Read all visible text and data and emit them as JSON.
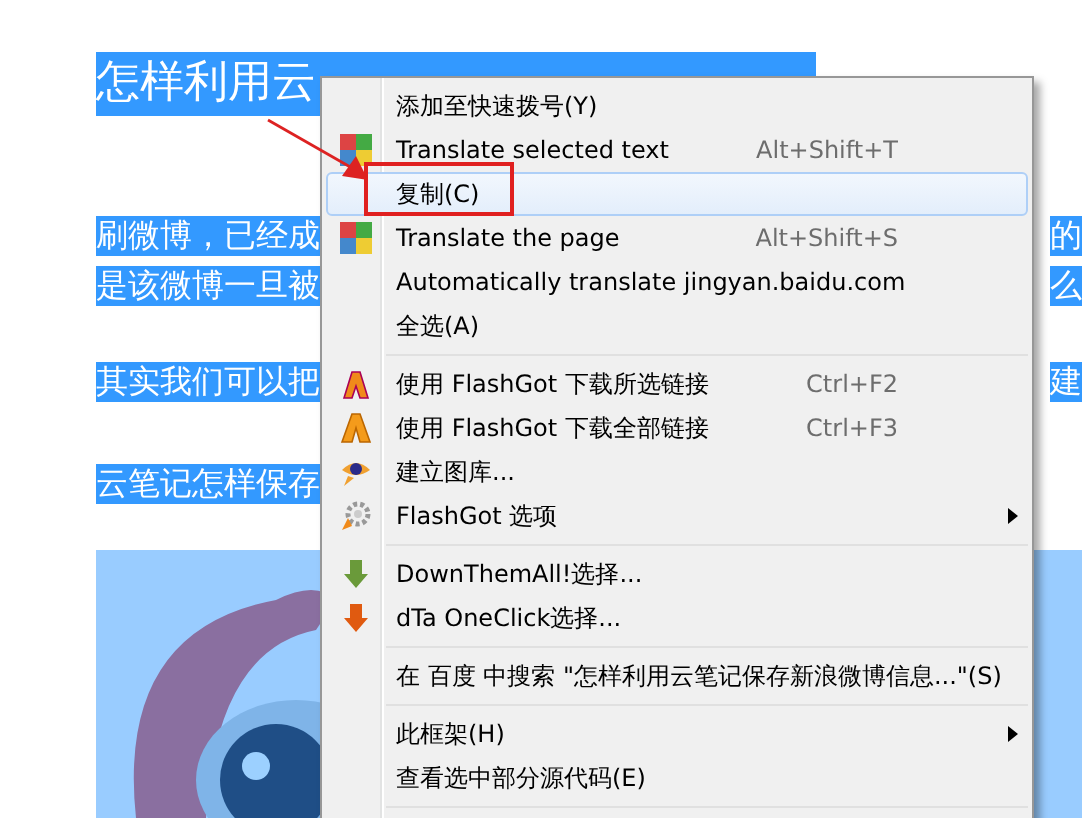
{
  "article": {
    "title": "怎样利用云",
    "lines": [
      {
        "left": "刷微博，已经成",
        "right": "的"
      },
      {
        "left": "是该微博一旦被",
        "right": "么"
      },
      {
        "left": "其实我们可以把",
        "right": "建"
      },
      {
        "left": "云笔记怎样保存"
      }
    ]
  },
  "context_menu": {
    "items": [
      {
        "kind": "plain",
        "label": "添加至快速拨号(Y)",
        "submenu": false,
        "selected": false
      },
      {
        "kind": "translate",
        "label": "Translate selected text",
        "shortcut": "Alt+Shift+T",
        "submenu": false,
        "selected": false
      },
      {
        "kind": "plain",
        "label": "复制(C)",
        "submenu": false,
        "selected": true
      },
      {
        "kind": "translate",
        "label": "Translate the page",
        "shortcut": "Alt+Shift+S",
        "submenu": false,
        "selected": false
      },
      {
        "kind": "plain",
        "label": "Automatically translate jingyan.baidu.com",
        "submenu": false,
        "selected": false
      },
      {
        "kind": "plain",
        "label": "全选(A)",
        "submenu": false,
        "selected": false
      },
      {
        "kind": "separator"
      },
      {
        "kind": "flashgot",
        "label": "使用 FlashGot 下载所选链接",
        "shortcut": "Ctrl+F2",
        "submenu": false,
        "selected": false
      },
      {
        "kind": "flashgot",
        "label": "使用 FlashGot 下载全部链接",
        "shortcut": "Ctrl+F3",
        "submenu": false,
        "selected": false
      },
      {
        "kind": "gallery",
        "label": "建立图库...",
        "submenu": false,
        "selected": false
      },
      {
        "kind": "options",
        "label": "FlashGot 选项",
        "submenu": true,
        "selected": false
      },
      {
        "kind": "separator"
      },
      {
        "kind": "downthemall",
        "label": "DownThemAll!选择...",
        "submenu": false,
        "selected": false
      },
      {
        "kind": "oneclick",
        "label": "dTa OneClick选择...",
        "submenu": false,
        "selected": false
      },
      {
        "kind": "separator"
      },
      {
        "kind": "plain",
        "label": "在 百度 中搜索 \"怎样利用云笔记保存新浪微博信息...\"(S)",
        "submenu": false,
        "selected": false
      },
      {
        "kind": "separator"
      },
      {
        "kind": "plain",
        "label": "此框架(H)",
        "submenu": true,
        "selected": false
      },
      {
        "kind": "plain",
        "label": "查看选中部分源代码(E)",
        "submenu": false,
        "selected": false
      },
      {
        "kind": "separator"
      }
    ]
  }
}
